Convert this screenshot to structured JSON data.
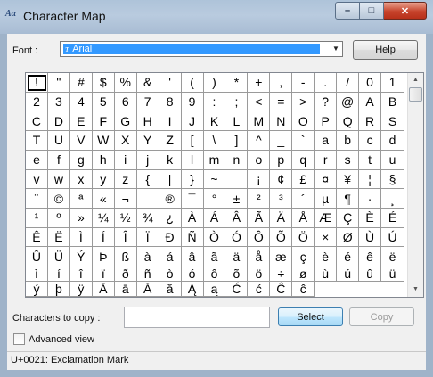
{
  "window": {
    "title": "Character Map",
    "app_icon": "character-map-icon",
    "minimize_glyph": "–",
    "maximize_glyph": "□",
    "close_glyph": "✕"
  },
  "font": {
    "label": "Font :",
    "value": "Arial",
    "value_icon": "truetype-font-icon"
  },
  "help_button": "Help",
  "characters": [
    "!",
    "\"",
    "#",
    "$",
    "%",
    "&",
    "'",
    "(",
    ")",
    "*",
    "+",
    ",",
    "-",
    ".",
    "/",
    "0",
    "1",
    "2",
    "3",
    "4",
    "5",
    "6",
    "7",
    "8",
    "9",
    ":",
    ";",
    "<",
    "=",
    ">",
    "?",
    "@",
    "A",
    "B",
    "C",
    "D",
    "E",
    "F",
    "G",
    "H",
    "I",
    "J",
    "K",
    "L",
    "M",
    "N",
    "O",
    "P",
    "Q",
    "R",
    "S",
    "T",
    "U",
    "V",
    "W",
    "X",
    "Y",
    "Z",
    "[",
    "\\",
    "]",
    "^",
    "_",
    "`",
    "a",
    "b",
    "c",
    "d",
    "e",
    "f",
    "g",
    "h",
    "i",
    "j",
    "k",
    "l",
    "m",
    "n",
    "o",
    "p",
    "q",
    "r",
    "s",
    "t",
    "u",
    "v",
    "w",
    "x",
    "y",
    "z",
    "{",
    "|",
    "}",
    "~",
    " ",
    "¡",
    "¢",
    "£",
    "¤",
    "¥",
    "¦",
    "§",
    "¨",
    "©",
    "ª",
    "«",
    "¬",
    "­",
    "®",
    "¯",
    "°",
    "±",
    "²",
    "³",
    "´",
    "µ",
    "¶",
    "·",
    "¸",
    "¹",
    "º",
    "»",
    "¼",
    "½",
    "¾",
    "¿",
    "À",
    "Á",
    "Â",
    "Ã",
    "Ä",
    "Å",
    "Æ",
    "Ç",
    "È",
    "É",
    "Ê",
    "Ë",
    "Ì",
    "Í",
    "Î",
    "Ï",
    "Ð",
    "Ñ",
    "Ò",
    "Ó",
    "Ô",
    "Õ",
    "Ö",
    "×",
    "Ø",
    "Ù",
    "Ú",
    "Û",
    "Ü",
    "Ý",
    "Þ",
    "ß",
    "à",
    "á",
    "â",
    "ã",
    "ä",
    "å",
    "æ",
    "ç",
    "è",
    "é",
    "ê",
    "ë",
    "ì",
    "í",
    "î",
    "ï",
    "ð",
    "ñ",
    "ò",
    "ó",
    "ô",
    "õ",
    "ö",
    "÷",
    "ø",
    "ù",
    "ú",
    "û",
    "ü",
    "ý",
    "þ",
    "ÿ",
    "Ā",
    "ā",
    "Ă",
    "ă",
    "Ą",
    "ą",
    "Ć",
    "ć",
    "Ĉ",
    "ĉ"
  ],
  "selected_index": 0,
  "copy": {
    "label": "Characters to copy :",
    "value": "",
    "select_button": "Select",
    "copy_button": "Copy"
  },
  "advanced_view": {
    "label": "Advanced view",
    "checked": false
  },
  "status": "U+0021: Exclamation Mark",
  "scrollbar": {
    "up_icon": "scroll-up-arrow-icon",
    "down_icon": "scroll-down-arrow-icon",
    "up_glyph": "▲",
    "down_glyph": "▼"
  },
  "colors": {
    "selection_blue": "#3399ff",
    "title_bar": "#b9cbdf",
    "close_red": "#c7432b"
  }
}
